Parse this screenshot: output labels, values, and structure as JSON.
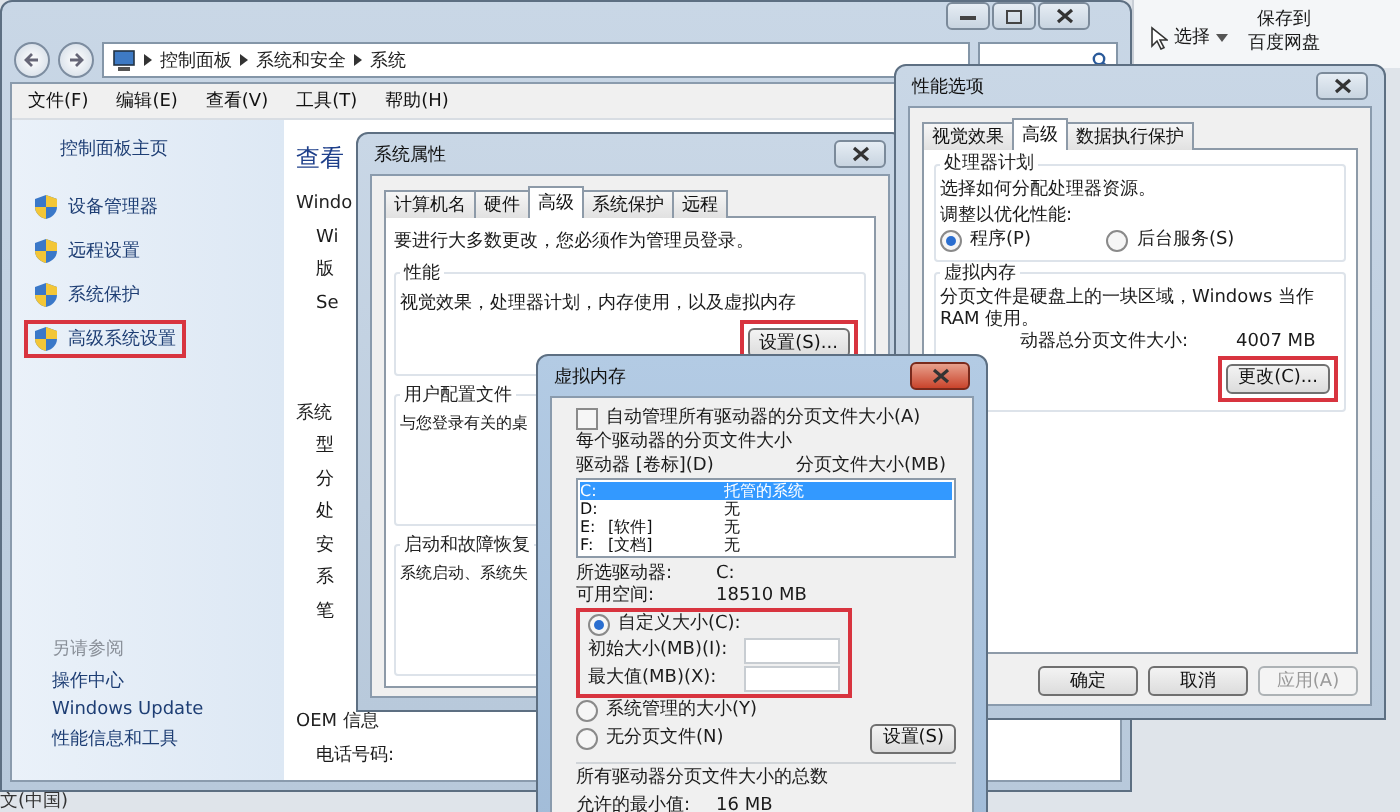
{
  "background_app": {
    "ribbon": [
      {
        "kind": "tool",
        "lines": [
          "选择"
        ]
      },
      {
        "kind": "stacked",
        "lines": [
          "保存到",
          "百度网盘"
        ]
      }
    ],
    "status_text": "文(中国)"
  },
  "control_panel": {
    "breadcrumb": [
      "控制面板",
      "系统和安全",
      "系统"
    ],
    "menu": [
      "文件(F)",
      "编辑(E)",
      "查看(V)",
      "工具(T)",
      "帮助(H)"
    ],
    "sidebar": {
      "home": "控制面板主页",
      "items": [
        {
          "label": "设备管理器",
          "highlighted": false
        },
        {
          "label": "远程设置",
          "highlighted": false
        },
        {
          "label": "系统保护",
          "highlighted": false
        },
        {
          "label": "高级系统设置",
          "highlighted": true
        }
      ],
      "see_also_title": "另请参阅",
      "see_also": [
        "操作中心",
        "Windows Update",
        "性能信息和工具"
      ]
    },
    "main": [
      {
        "kind": "heading",
        "text": "查看"
      },
      {
        "kind": "section",
        "text": "Windo"
      },
      {
        "kind": "row",
        "text": "Wi"
      },
      {
        "kind": "row",
        "text": "版"
      },
      {
        "kind": "row",
        "text": "Se"
      },
      {
        "kind": "section",
        "text": "系统"
      },
      {
        "kind": "row",
        "text": "型"
      },
      {
        "kind": "row",
        "text": "分"
      },
      {
        "kind": "row",
        "text": "处"
      },
      {
        "kind": "row",
        "text": "安"
      },
      {
        "kind": "row",
        "text": "系"
      },
      {
        "kind": "row",
        "text": "笔"
      },
      {
        "kind": "section",
        "text": "OEM 信息"
      },
      {
        "kind": "row",
        "text": "电话号码:"
      }
    ]
  },
  "system_properties": {
    "title": "系统属性",
    "tabs": [
      {
        "label": "计算机名",
        "selected": false
      },
      {
        "label": "硬件",
        "selected": false
      },
      {
        "label": "高级",
        "selected": true
      },
      {
        "label": "系统保护",
        "selected": false
      },
      {
        "label": "远程",
        "selected": false
      }
    ],
    "notice": "要进行大多数更改，您必须作为管理员登录。",
    "groups": [
      {
        "title": "性能",
        "text": "视觉效果，处理器计划，内存使用，以及虚拟内存",
        "button": {
          "label": "设置(S)...",
          "highlighted": true
        }
      },
      {
        "title": "用户配置文件",
        "text": "与您登录有关的桌"
      },
      {
        "title": "启动和故障恢复",
        "text": "系统启动、系统失"
      }
    ]
  },
  "performance_options": {
    "title": "性能选项",
    "tabs": [
      {
        "label": "视觉效果",
        "selected": false
      },
      {
        "label": "高级",
        "selected": true
      },
      {
        "label": "数据执行保护",
        "selected": false
      }
    ],
    "processor": {
      "title": "处理器计划",
      "text": "选择如何分配处理器资源。",
      "prompt": "调整以优化性能:",
      "options": [
        {
          "label": "程序(P)",
          "selected": true
        },
        {
          "label": "后台服务(S)",
          "selected": false
        }
      ]
    },
    "virtual_memory": {
      "title": "虚拟内存",
      "text": "分页文件是硬盘上的一块区域，Windows 当作 RAM 使用。",
      "total_label": "动器总分页文件大小:",
      "total_value": "4007 MB",
      "button": {
        "label": "更改(C)...",
        "highlighted": true
      }
    },
    "buttons": [
      {
        "label": "确定",
        "disabled": false
      },
      {
        "label": "取消",
        "disabled": false
      },
      {
        "label": "应用(A)",
        "disabled": true
      }
    ]
  },
  "virtual_memory": {
    "title": "虚拟内存",
    "auto_manage": {
      "label": "自动管理所有驱动器的分页文件大小(A)",
      "checked": false
    },
    "per_drive_title": "每个驱动器的分页文件大小",
    "columns": [
      "驱动器 [卷标](D)",
      "分页文件大小(MB)"
    ],
    "drives": [
      {
        "drive": "C:",
        "size": "托管的系统",
        "selected": true
      },
      {
        "drive": "D:",
        "size": "无",
        "selected": false
      },
      {
        "drive": "E:",
        "volume": "[软件]",
        "size": "无",
        "selected": false
      },
      {
        "drive": "F:",
        "volume": "[文档]",
        "size": "无",
        "selected": false
      }
    ],
    "info": [
      {
        "label": "所选驱动器:",
        "value": "C:"
      },
      {
        "label": "可用空间:",
        "value": "18510 MB"
      }
    ],
    "custom_size": {
      "label": "自定义大小(C):",
      "selected": true,
      "highlighted": true,
      "fields": [
        {
          "label": "初始大小(MB)(I):"
        },
        {
          "label": "最大值(MB)(X):"
        }
      ]
    },
    "other_options": [
      {
        "label": "系统管理的大小(Y)",
        "selected": false
      },
      {
        "label": "无分页文件(N)",
        "selected": false
      }
    ],
    "set_button": "设置(S)",
    "totals_title": "所有驱动器分页文件大小的总数",
    "totals": [
      {
        "label": "允许的最小值:",
        "value": "16 MB"
      }
    ]
  }
}
